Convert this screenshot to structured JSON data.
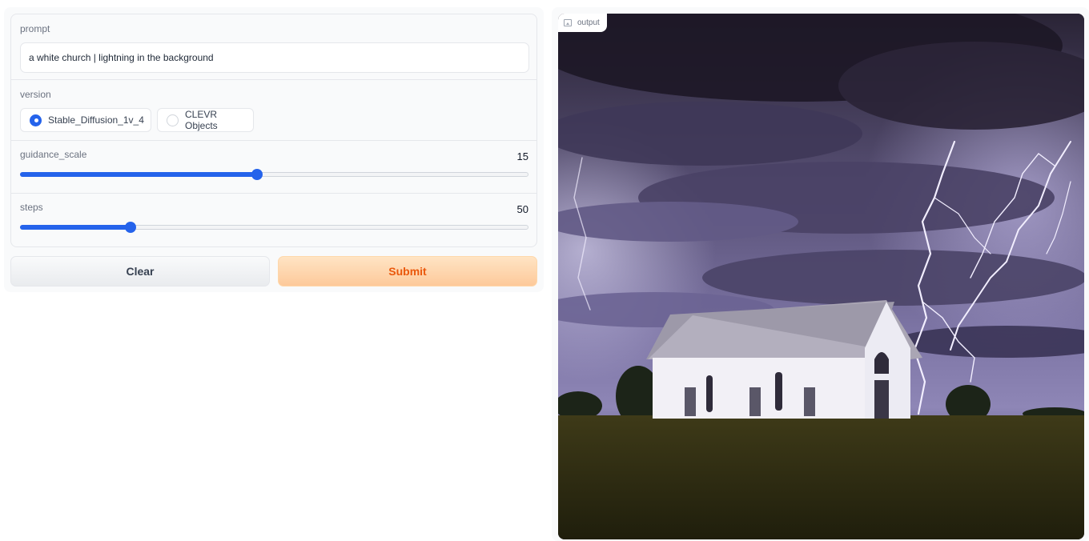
{
  "inputs": {
    "prompt": {
      "label": "prompt",
      "value": "a white church | lightning in the background"
    },
    "version": {
      "label": "version",
      "options": [
        "Stable_Diffusion_1v_4",
        "CLEVR Objects"
      ],
      "selected": "Stable_Diffusion_1v_4"
    },
    "guidance_scale": {
      "label": "guidance_scale",
      "value": "15",
      "fraction": 0.466
    },
    "steps": {
      "label": "steps",
      "value": "50",
      "fraction": 0.217
    }
  },
  "actions": {
    "clear_label": "Clear",
    "submit_label": "Submit"
  },
  "output": {
    "label": "output",
    "icon": "image-icon",
    "image_description_icon": "generated-image"
  },
  "colors": {
    "accent": "#2563eb",
    "submit_text": "#ea580c",
    "submit_bg": "#fdc99a"
  }
}
